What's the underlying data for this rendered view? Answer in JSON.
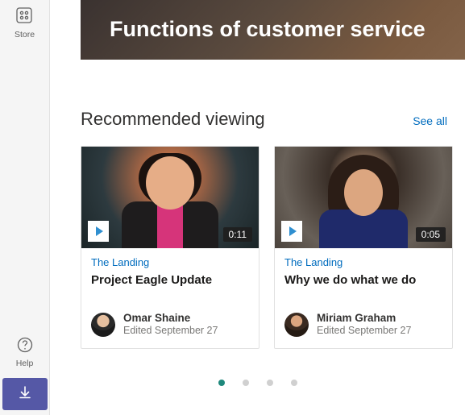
{
  "sidebar": {
    "store_label": "Store",
    "help_label": "Help"
  },
  "hero": {
    "title": "Functions of customer service"
  },
  "recommended": {
    "title": "Recommended viewing",
    "see_all": "See all",
    "cards": [
      {
        "duration": "0:11",
        "site": "The Landing",
        "title": "Project Eagle Update",
        "author": "Omar Shaine",
        "edited": "Edited September 27"
      },
      {
        "duration": "0:05",
        "site": "The Landing",
        "title": "Why we do what we do",
        "author": "Miriam Graham",
        "edited": "Edited September 27"
      }
    ]
  }
}
